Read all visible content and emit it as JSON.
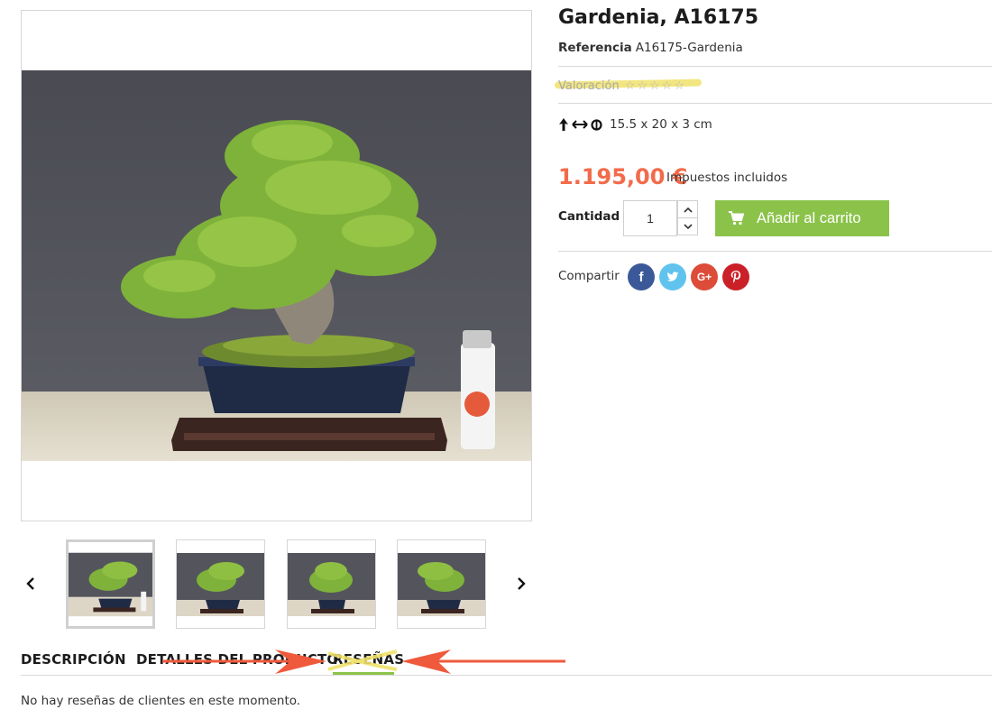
{
  "product": {
    "title": "Gardenia, A16175",
    "reference_label": "Referencia",
    "reference_value": "A16175-Gardenia",
    "rating_label": "Valoración",
    "rating_stars": 0,
    "rating_max": 5,
    "dimensions": "15.5 x 20 x 3 cm",
    "price": "1.195,00 €",
    "tax_note": "Impuestos incluidos",
    "quantity_label": "Cantidad",
    "quantity_value": "1",
    "add_to_cart_label": "Añadir al carrito",
    "share_label": "Compartir"
  },
  "social": {
    "facebook_glyph": "f",
    "googleplus_glyph": "G+"
  },
  "gallery": {
    "thumbnail_count": 4,
    "selected_index": 0
  },
  "tabs": {
    "items": [
      "DESCRIPCIÓN",
      "DETALLES DEL PRODUCTO",
      "RESEÑAS"
    ],
    "active_index": 2,
    "content": "No hay reseñas de clientes en este momento."
  },
  "colors": {
    "price": "#f26b4b",
    "add_to_cart": "#8bc34a",
    "tab_underline": "#8bc34a",
    "facebook": "#3b5998",
    "twitter": "#5fc3ee",
    "googleplus": "#dd4b39",
    "pinterest": "#cb2027",
    "annotation_arrow": "#ef5a3c",
    "annotation_highlight": "#f0e26b"
  },
  "icons": {
    "prev": "chevron-left-icon",
    "next": "chevron-right-icon",
    "height": "arrow-up-icon",
    "width": "arrow-left-right-icon",
    "depth": "depth-icon",
    "cart": "cart-icon",
    "qty_up": "chevron-up-icon",
    "qty_down": "chevron-down-icon"
  }
}
